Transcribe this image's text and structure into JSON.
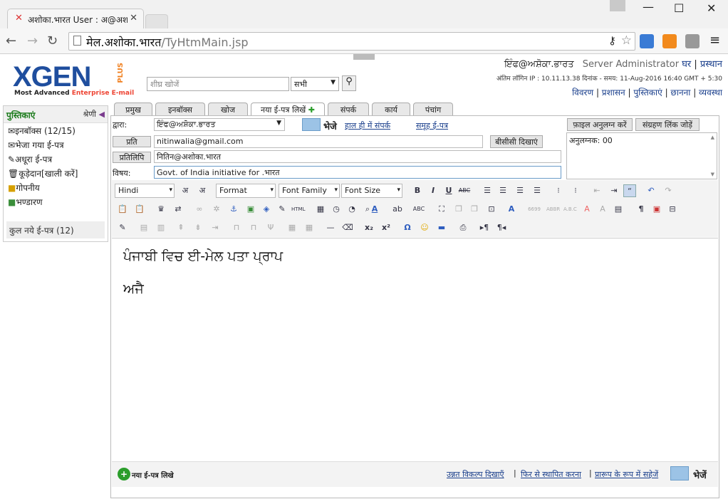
{
  "browser": {
    "tab_title": "अशोका.भारत User : अ@अश",
    "url_host": "मेल.अशोका.भारत",
    "url_path": "/TyHtmMain.jsp"
  },
  "header": {
    "user_email": "ਇੰਫ@ਅਸ਼ੋਕਾ.ਭਾਰਤ",
    "role": "Server Administrator",
    "home": "घर",
    "logout": "प्रस्थान",
    "last_login": "अंतिम लॉगिन IP : 10.11.13.38 दिनांक - समय: 11-Aug-2016 16:40 GMT + 5:30",
    "links": [
      "विवरण",
      "प्रशासन",
      "पुस्तिकाएं",
      "छानना",
      "व्यवस्था"
    ],
    "search_placeholder": "शीघ्र खोजें",
    "search_scope": "सभी"
  },
  "logo": {
    "text": "XGEN",
    "plus": "PLUS",
    "tagline_a": "Most Advanced ",
    "tagline_b": "Enterprise E-mail"
  },
  "sidebar": {
    "title": "पुस्तिकाएं",
    "category": "श्रेणी",
    "items": [
      {
        "label": "इनबॉक्स (12/15)",
        "icon": "inbox-icon"
      },
      {
        "label": "भेजा गया ई-पत्र",
        "icon": "sent-icon"
      },
      {
        "label": "अधूरा ई-पत्र",
        "icon": "draft-icon"
      },
      {
        "label": "कूड़ेदान[खाली करें]",
        "icon": "trash-icon"
      },
      {
        "label": "गोपनीय",
        "icon": "lock-icon"
      },
      {
        "label": "भण्डारण",
        "icon": "archive-icon"
      }
    ],
    "footer": "कुल नये ई-पत्र (12)"
  },
  "tabs": [
    "प्रमुख",
    "इनबॉक्स",
    "खोज",
    "नया ई-पत्र लिखें",
    "संपर्क",
    "कार्य",
    "पंचांग"
  ],
  "compose": {
    "from_label": "द्वारा:",
    "from_value": "ਇੰਫ@ਅਸ਼ੋਕਾ.ਭਾਰਤ",
    "send_label": "भेजे",
    "recent_contacts": "हाल ही में संपर्क",
    "group_mail": "समूह ई-पत्र",
    "to_label": "प्रति",
    "to_value": "nitinwalia@gmail.com",
    "bcc_btn": "बीसीसी  दिखाएं",
    "cc_label": "प्रतिलिपि",
    "cc_value": "नितिन@अशोका.भारत",
    "subject_label": "विषय:",
    "subject_value": "Govt. of India initiative for .भारत",
    "attach_btn": "फ़ाइल अनुलग्न करें",
    "archive_link_btn": "संग्रहण लिंक जोड़ें",
    "attach_area": "अनुलग्नक: 00"
  },
  "toolbar": {
    "language": "Hindi",
    "format": "Format",
    "font_family": "Font Family",
    "font_size": "Font Size"
  },
  "editor": {
    "line1": "ਪੰਜਾਬੀ ਵਿਚ ਈ-ਮੇਲ ਪਤਾ ਪ੍ਰਾਪ",
    "line2": "ਅਜੈ"
  },
  "footer": {
    "new_mail": "नया ई-पत्र लिखे",
    "advanced": "उन्नत विकल्प दिखाएँ",
    "reinstall": "फिर से स्थापित करना",
    "save_draft": "प्रारूप के रूप में सहेजें",
    "send": "भेजें"
  }
}
